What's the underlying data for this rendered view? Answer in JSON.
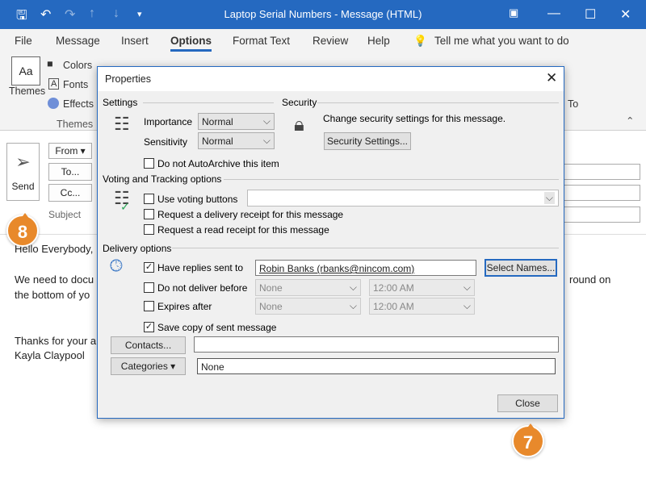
{
  "window": {
    "title": "Laptop Serial Numbers - Message (HTML)"
  },
  "menu": {
    "items": [
      "File",
      "Message",
      "Insert",
      "Options",
      "Format Text",
      "Review",
      "Help"
    ],
    "tell_me": "Tell me what you want to do"
  },
  "ribbon": {
    "themes": "Themes",
    "colors": "Colors",
    "fonts": "Fonts",
    "effects": "Effects",
    "group_themes": "Themes",
    "partial_to": "To"
  },
  "compose": {
    "send": "Send",
    "from": "From",
    "to": "To...",
    "cc": "Cc...",
    "subject": "Subject",
    "body": [
      "Hello Everybody,",
      "We need to docu",
      "the bottom of yo",
      "Thanks for your a",
      "Kayla Claypool"
    ],
    "body_right": "round on"
  },
  "dialog": {
    "title": "Properties",
    "settings": {
      "heading": "Settings",
      "importance_label": "Importance",
      "importance": "Normal",
      "sensitivity_label": "Sensitivity",
      "sensitivity": "Normal",
      "autoarchive": "Do not AutoArchive this item",
      "autoarchive_checked": false
    },
    "security": {
      "heading": "Security",
      "text": "Change security settings for this message.",
      "button": "Security Settings..."
    },
    "voting": {
      "heading": "Voting and Tracking options",
      "use_voting": "Use voting buttons",
      "voting_value": "",
      "delivery_receipt": "Request a delivery receipt for this message",
      "read_receipt": "Request a read receipt for this message"
    },
    "delivery": {
      "heading": "Delivery options",
      "replies_label": "Have replies sent to",
      "replies_checked": true,
      "replies_value": "Robin Banks (rbanks@nincom.com)",
      "select_names": "Select Names...",
      "not_before_label": "Do not deliver before",
      "not_before_date": "None",
      "not_before_time": "12:00 AM",
      "expires_label": "Expires after",
      "expires_date": "None",
      "expires_time": "12:00 AM",
      "save_copy": "Save copy of sent message",
      "save_copy_checked": true
    },
    "contacts": "Contacts...",
    "contacts_value": "",
    "categories": "Categories",
    "categories_value": "None",
    "close": "Close"
  },
  "callouts": {
    "send_step": "8",
    "close_step": "7",
    "color": "#e8892b"
  }
}
